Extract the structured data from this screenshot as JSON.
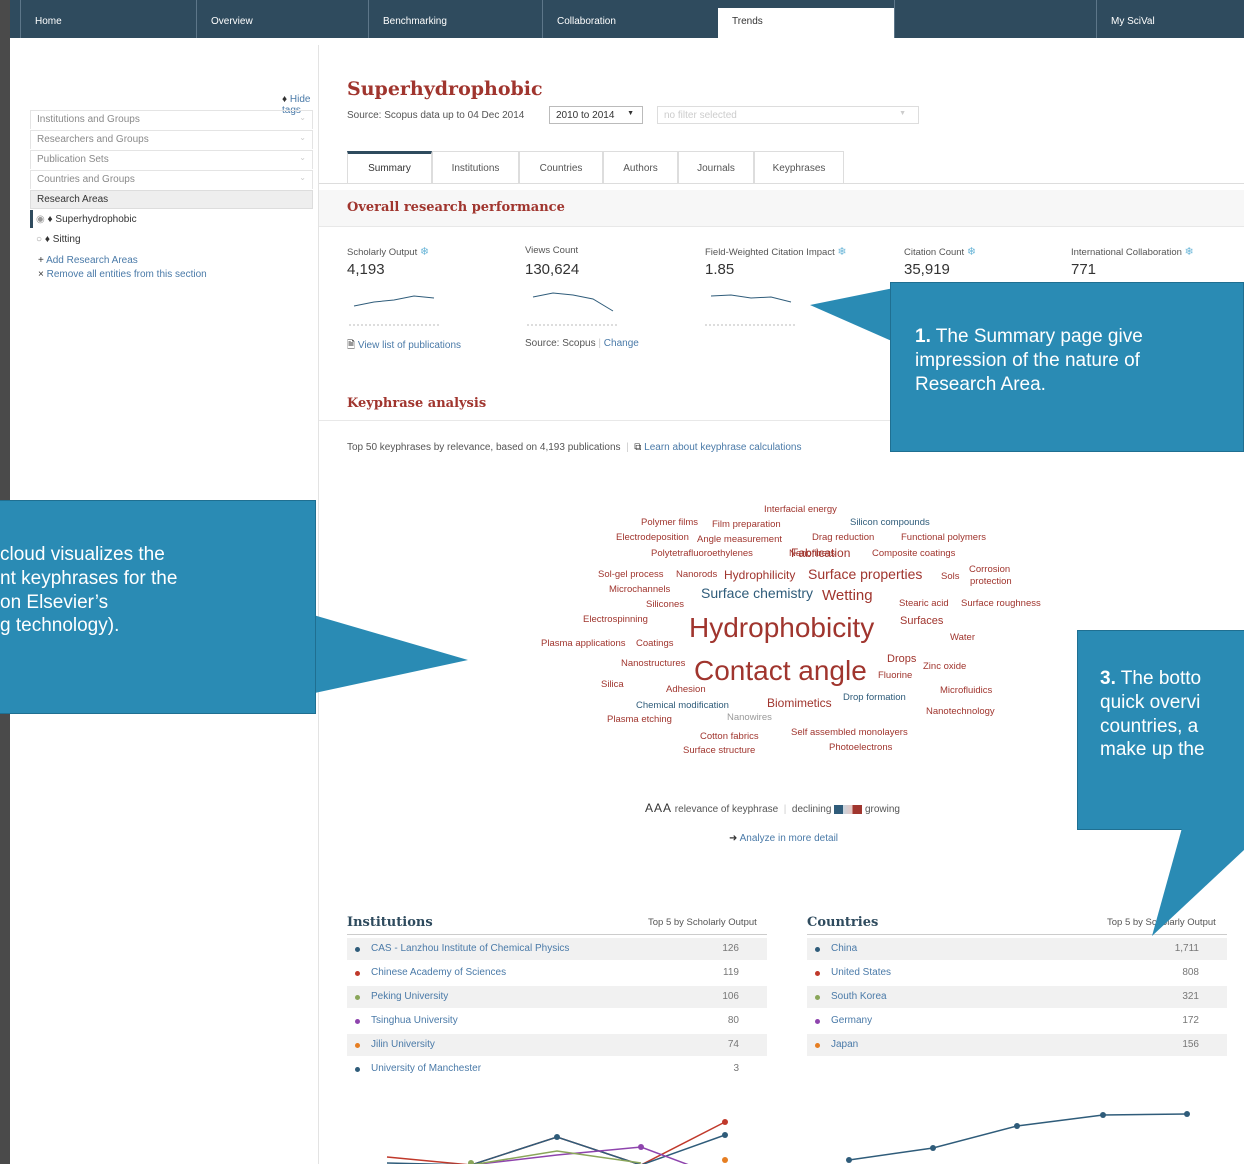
{
  "nav": {
    "items": [
      "Home",
      "Overview",
      "Benchmarking",
      "Collaboration",
      "Trends",
      "",
      "My SciVal"
    ]
  },
  "sidebar": {
    "hide_tags": "Hide tags",
    "sections": [
      "Institutions and Groups",
      "Researchers and Groups",
      "Publication Sets",
      "Countries and Groups"
    ],
    "research_areas_header": "Research Areas",
    "items": [
      "Superhydrophobic",
      "Sitting"
    ],
    "add_link": "Add Research Areas",
    "remove_link": "Remove all entities from this section"
  },
  "header": {
    "title": "Superhydrophobic",
    "source": "Source: Scopus data up to 04 Dec 2014",
    "year_range": "2010 to 2014",
    "filter_placeholder": "no filter selected"
  },
  "tabs": [
    "Summary",
    "Institutions",
    "Countries",
    "Authors",
    "Journals",
    "Keyphrases"
  ],
  "overall": {
    "title": "Overall research performance",
    "metrics": [
      {
        "label": "Scholarly Output",
        "value": "4,193"
      },
      {
        "label": "Views Count",
        "value": "130,624"
      },
      {
        "label": "Field-Weighted Citation Impact",
        "value": "1.85"
      },
      {
        "label": "Citation Count",
        "value": "35,919"
      },
      {
        "label": "International Collaboration",
        "value": "771"
      }
    ],
    "view_list": "View list of publications",
    "source": "Source: Scopus",
    "change": "Change"
  },
  "keyphrase": {
    "title": "Keyphrase analysis",
    "subtitle": "Top 50 keyphrases by relevance, based on 4,193 publications",
    "learn": "Learn about keyphrase calculations",
    "legend_aaa": "AAA",
    "legend_relevance": "relevance of keyphrase",
    "legend_declining": "declining",
    "legend_growing": "growing",
    "analyze": "Analyze in more detail",
    "words": [
      {
        "t": "Interfacial energy",
        "c": "#a0352e"
      },
      {
        "t": "Polymer films",
        "c": "#a0352e"
      },
      {
        "t": "Film preparation",
        "c": "#a0352e"
      },
      {
        "t": "Silicon compounds",
        "c": "#2f5c7a"
      },
      {
        "t": "Electrodeposition",
        "c": "#a0352e"
      },
      {
        "t": "Angle measurement",
        "c": "#a0352e"
      },
      {
        "t": "Drag reduction",
        "c": "#a0352e"
      },
      {
        "t": "Functional polymers",
        "c": "#a0352e"
      },
      {
        "t": "Polytetrafluoroethylenes",
        "c": "#a0352e"
      },
      {
        "t": "Nanofibers",
        "c": "#a0352e"
      },
      {
        "t": "Fabrication",
        "c": "#a0352e"
      },
      {
        "t": "Composite coatings",
        "c": "#a0352e"
      },
      {
        "t": "Sol-gel process",
        "c": "#a0352e"
      },
      {
        "t": "Nanorods",
        "c": "#a0352e"
      },
      {
        "t": "Hydrophilicity",
        "c": "#a0352e"
      },
      {
        "t": "Surface properties",
        "c": "#a0352e"
      },
      {
        "t": "Sols",
        "c": "#a0352e"
      },
      {
        "t": "Corrosion",
        "c": "#a0352e"
      },
      {
        "t": "protection",
        "c": "#a0352e"
      },
      {
        "t": "Microchannels",
        "c": "#a0352e"
      },
      {
        "t": "Surface chemistry",
        "c": "#2f5c7a"
      },
      {
        "t": "Wetting",
        "c": "#a0352e"
      },
      {
        "t": "Silicones",
        "c": "#a0352e"
      },
      {
        "t": "Stearic acid",
        "c": "#a0352e"
      },
      {
        "t": "Surface roughness",
        "c": "#a0352e"
      },
      {
        "t": "Electrospinning",
        "c": "#a0352e"
      },
      {
        "t": "Hydrophobicity",
        "c": "#a0352e"
      },
      {
        "t": "Surfaces",
        "c": "#a0352e"
      },
      {
        "t": "Plasma applications",
        "c": "#a0352e"
      },
      {
        "t": "Coatings",
        "c": "#a0352e"
      },
      {
        "t": "Water",
        "c": "#a0352e"
      },
      {
        "t": "Nanostructures",
        "c": "#a0352e"
      },
      {
        "t": "Drops",
        "c": "#a0352e"
      },
      {
        "t": "Zinc oxide",
        "c": "#a0352e"
      },
      {
        "t": "Contact angle",
        "c": "#a0352e"
      },
      {
        "t": "Fluorine",
        "c": "#a0352e"
      },
      {
        "t": "Silica",
        "c": "#a0352e"
      },
      {
        "t": "Adhesion",
        "c": "#a0352e"
      },
      {
        "t": "Microfluidics",
        "c": "#a0352e"
      },
      {
        "t": "Biomimetics",
        "c": "#a0352e"
      },
      {
        "t": "Drop formation",
        "c": "#2f5c7a"
      },
      {
        "t": "Chemical modification",
        "c": "#2f5c7a"
      },
      {
        "t": "Nanotechnology",
        "c": "#a0352e"
      },
      {
        "t": "Plasma etching",
        "c": "#a0352e"
      },
      {
        "t": "Nanowires",
        "c": "#999999"
      },
      {
        "t": "Cotton fabrics",
        "c": "#a0352e"
      },
      {
        "t": "Self assembled monolayers",
        "c": "#a0352e"
      },
      {
        "t": "Surface structure",
        "c": "#a0352e"
      },
      {
        "t": "Photoelectrons",
        "c": "#a0352e"
      }
    ]
  },
  "institutions": {
    "title": "Institutions",
    "sub": "Top 5 by Scholarly Output",
    "rows": [
      {
        "name": "CAS - Lanzhou Institute of Chemical Physics",
        "value": "126",
        "color": "#2f5c7a"
      },
      {
        "name": "Chinese Academy of Sciences",
        "value": "119",
        "color": "#c0392b"
      },
      {
        "name": "Peking University",
        "value": "106",
        "color": "#8aa65a"
      },
      {
        "name": "Tsinghua University",
        "value": "80",
        "color": "#8e44ad"
      },
      {
        "name": "Jilin University",
        "value": "74",
        "color": "#e67e22"
      },
      {
        "name": "University of Manchester",
        "value": "3",
        "color": "#2f5c7a"
      }
    ]
  },
  "countries": {
    "title": "Countries",
    "sub": "Top 5 by Scholarly Output",
    "rows": [
      {
        "name": "China",
        "value": "1,711",
        "color": "#2f5c7a"
      },
      {
        "name": "United States",
        "value": "808",
        "color": "#c0392b"
      },
      {
        "name": "South Korea",
        "value": "321",
        "color": "#8aa65a"
      },
      {
        "name": "Germany",
        "value": "172",
        "color": "#8e44ad"
      },
      {
        "name": "Japan",
        "value": "156",
        "color": "#e67e22"
      }
    ]
  },
  "callouts": {
    "one_num": "1.",
    "one_text": " The Summary page give",
    "one_line2": "impression of the nature of",
    "one_line3": "Research Area.",
    "two_line1": "cloud visualizes the",
    "two_line2": "nt keyphrases for the",
    "two_line3": "on Elsevier’s",
    "two_line4": "g technology).",
    "three_num": "3.",
    "three_line1": " The botto",
    "three_line2": "quick overvi",
    "three_line3": "countries, a",
    "three_line4": "make up the"
  },
  "colors": {
    "nav": "#2f4b5e",
    "accent": "#a0352e",
    "link": "#4a7aa8",
    "callout": "#2a8bb4"
  }
}
